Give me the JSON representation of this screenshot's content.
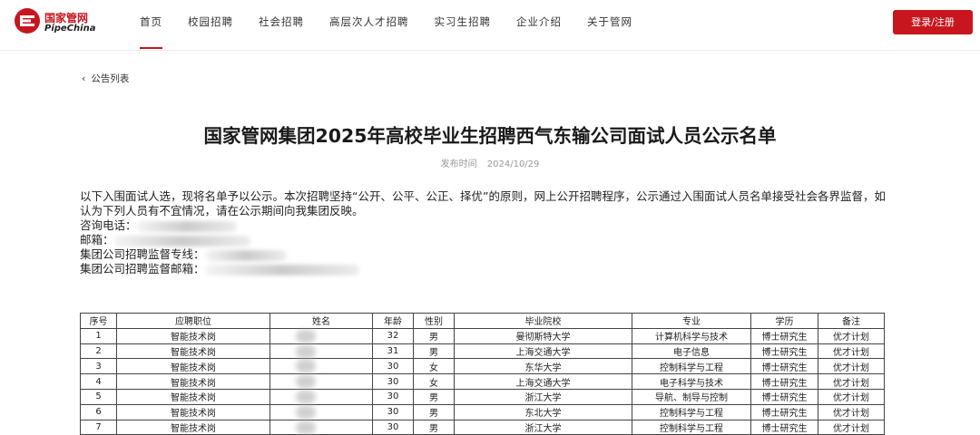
{
  "brand": {
    "name_cn": "国家管网",
    "name_en": "PipeChina",
    "accent": "#c8161e"
  },
  "nav": {
    "items": [
      "首页",
      "校园招聘",
      "社会招聘",
      "高层次人才招聘",
      "实习生招聘",
      "企业介绍",
      "关于管网"
    ],
    "active": "首页"
  },
  "login_label": "登录/注册",
  "back_label": "公告列表",
  "article": {
    "title": "国家管网集团2025年高校毕业生招聘西气东输公司面试人员公示名单",
    "publish_label": "发布时间",
    "publish_date": "2024/10/29",
    "intro": "以下入围面试人选，现将名单予以公示。本次招聘坚持“公开、公平、公正、择优”的原则，网上公开招聘程序，公示通过入围面试人员名单接受社会各界监督，如认为下列人员有不宜情况，请在公示期间向我集团反映。",
    "contacts": [
      {
        "label": "咨询电话："
      },
      {
        "label": "邮箱："
      },
      {
        "label": "集团公司招聘监督专线："
      },
      {
        "label": "集团公司招聘监督邮箱："
      }
    ]
  },
  "table": {
    "headers": [
      "序号",
      "应聘职位",
      "姓名",
      "年龄",
      "性别",
      "毕业院校",
      "专业",
      "学历",
      "备注"
    ],
    "rows": [
      [
        "1",
        "智能技术岗",
        "",
        "32",
        "男",
        "曼彻斯特大学",
        "计算机科学与技术",
        "博士研究生",
        "优才计划"
      ],
      [
        "2",
        "智能技术岗",
        "",
        "31",
        "男",
        "上海交通大学",
        "电子信息",
        "博士研究生",
        "优才计划"
      ],
      [
        "3",
        "智能技术岗",
        "",
        "30",
        "女",
        "东华大学",
        "控制科学与工程",
        "博士研究生",
        "优才计划"
      ],
      [
        "4",
        "智能技术岗",
        "",
        "30",
        "女",
        "上海交通大学",
        "电子科学与技术",
        "博士研究生",
        "优才计划"
      ],
      [
        "5",
        "智能技术岗",
        "",
        "30",
        "男",
        "浙江大学",
        "导航、制导与控制",
        "博士研究生",
        "优才计划"
      ],
      [
        "6",
        "智能技术岗",
        "",
        "30",
        "男",
        "东北大学",
        "控制科学与工程",
        "博士研究生",
        "优才计划"
      ],
      [
        "7",
        "智能技术岗",
        "",
        "30",
        "男",
        "浙江大学",
        "控制科学与工程",
        "博士研究生",
        "优才计划"
      ]
    ]
  }
}
